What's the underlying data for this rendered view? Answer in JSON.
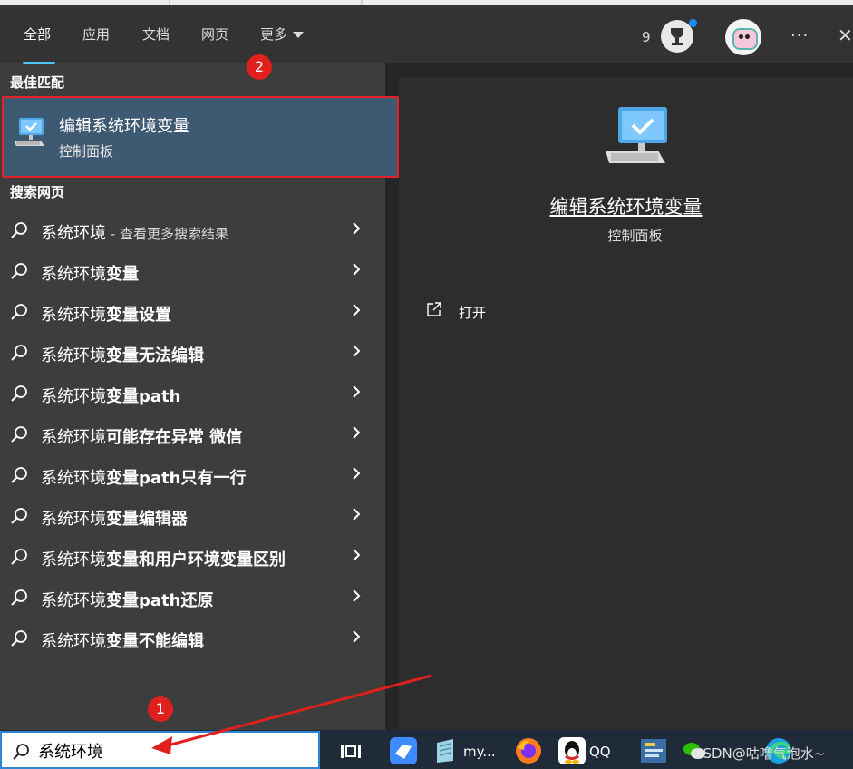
{
  "tabs": [
    {
      "label": "全部",
      "active": true
    },
    {
      "label": "应用"
    },
    {
      "label": "文档"
    },
    {
      "label": "网页"
    },
    {
      "label": "更多"
    }
  ],
  "header": {
    "points": "9",
    "trophy_icon": "trophy-icon",
    "more_options": "···",
    "close": "✕"
  },
  "annotations": {
    "badge_1": "1",
    "badge_2": "2",
    "color": "#e0201c"
  },
  "best_match": {
    "section_title": "最佳匹配",
    "title": "编辑系统环境变量",
    "subtitle": "控制面板",
    "icon": "computer-monitor-icon"
  },
  "web_search": {
    "section_title": "搜索网页",
    "results": [
      {
        "query": "系统环境",
        "rest": "",
        "hint": " - 查看更多搜索结果"
      },
      {
        "query": "系统环境",
        "rest": "变量"
      },
      {
        "query": "系统环境",
        "rest": "变量设置"
      },
      {
        "query": "系统环境",
        "rest": "变量无法编辑"
      },
      {
        "query": "系统环境",
        "rest": "变量path"
      },
      {
        "query": "系统环境",
        "rest": "可能存在异常 微信"
      },
      {
        "query": "系统环境",
        "rest": "变量path只有一行"
      },
      {
        "query": "系统环境",
        "rest": "变量编辑器"
      },
      {
        "query": "系统环境",
        "rest": "变量和用户环境变量区别"
      },
      {
        "query": "系统环境",
        "rest": "变量path还原"
      },
      {
        "query": "系统环境",
        "rest": "变量不能编辑"
      }
    ]
  },
  "preview": {
    "title": "编辑系统环境变量",
    "subtitle": "控制面板",
    "open_label": "打开"
  },
  "search": {
    "value": "系统环境"
  },
  "taskbar": {
    "app_my_label": "my...",
    "qq_label": "QQ",
    "watermark": "CSDN@咕噜气泡水~"
  },
  "colors": {
    "accent": "#4cc2ff",
    "selected_bg": "#3e5a72",
    "highlight_border": "#e8202a"
  }
}
